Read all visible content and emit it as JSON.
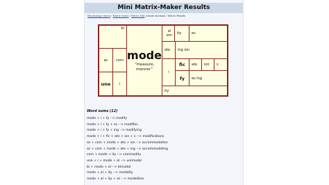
{
  "page": {
    "title": "Mini Matrix-Maker Results"
  },
  "breadcrumb": {
    "items": [
      "Morphology Home",
      "Matrix Home",
      "Matrix Edit"
    ],
    "note": "(closes window)",
    "current": "Matrix Results",
    "separator": "/"
  },
  "matrix": {
    "root": {
      "word": "mode",
      "gloss": "“measure, manner”"
    },
    "prefix_bi": "bi",
    "prefix_ac": "ac",
    "prefix_com": "com",
    "prefix_une": "une",
    "prefix_i": "i",
    "suffix_al_ern": "al ern",
    "suffix_ity_top": "ity",
    "suffix_es_top": "es",
    "suffix_ate": "ate",
    "suffix_ing_ion": "ing ion",
    "suffix_i": "i",
    "suffix_fic": "fic",
    "suffix_ate2": "ate",
    "suffix_ion": "ion",
    "suffix_s": "s",
    "suffix_fy": "fy",
    "suffix_es_ing": "es ing",
    "suffix_ity_bottom": "ity"
  },
  "word_sums": {
    "title": "Word sums (12)",
    "items": [
      "mode + i + fy --> modify",
      "mode + i + fy + es --> modifies",
      "mode + i + fy + ing --> modifying",
      "mode + i + fic + ate + ion + s --> modifications",
      "ac + com + mode + ate + ion --> accommodation",
      "ac + com + mode + ate + ing --> accommodating",
      "com + mode + ity --> commodity",
      "une + i + mode + al --> unimodal",
      "bi + mode + al --> bimodal",
      "mode + al + ity --> modality",
      "mode + al + ity + es --> modalities"
    ]
  },
  "colors": {
    "matrix_border": "#8b2421",
    "cell_background": "#fffee0",
    "title_bar": "#cbd8e6",
    "link": "#2a4a8f"
  }
}
